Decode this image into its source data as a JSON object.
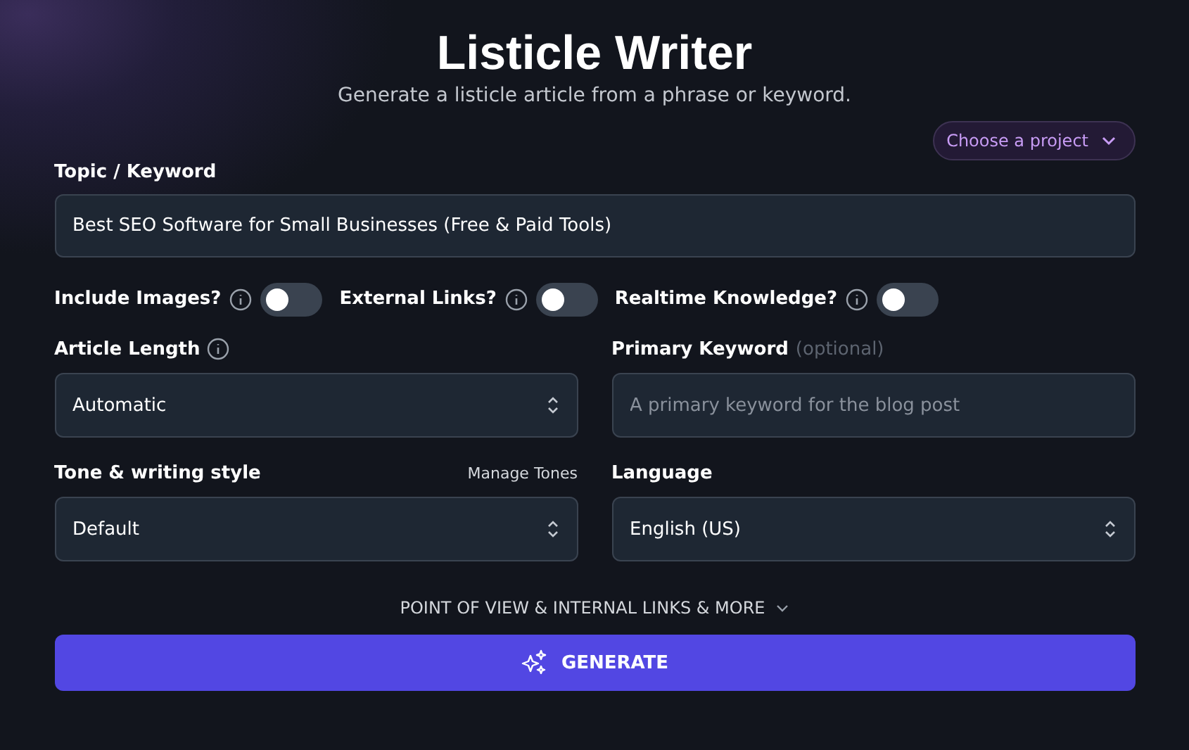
{
  "header": {
    "title": "Listicle Writer",
    "subtitle": "Generate a listicle article from a phrase or keyword."
  },
  "project_dropdown": {
    "label": "Choose a project"
  },
  "topic": {
    "label": "Topic / Keyword",
    "value": "Best SEO Software for Small Businesses (Free & Paid Tools)"
  },
  "toggles": [
    {
      "label": "Include Images?",
      "on": false
    },
    {
      "label": "External Links?",
      "on": false
    },
    {
      "label": "Realtime Knowledge?",
      "on": false
    }
  ],
  "article_length": {
    "label": "Article Length",
    "value": "Automatic"
  },
  "primary_keyword": {
    "label": "Primary Keyword",
    "hint": "(optional)",
    "placeholder": "A primary keyword for the blog post"
  },
  "tone": {
    "label": "Tone & writing style",
    "link": "Manage Tones",
    "value": "Default"
  },
  "language": {
    "label": "Language",
    "value": "English (US)"
  },
  "more_options": {
    "label": "POINT OF VIEW & INTERNAL LINKS & MORE",
    "expanded": false
  },
  "generate_button": {
    "label": "GENERATE"
  }
}
